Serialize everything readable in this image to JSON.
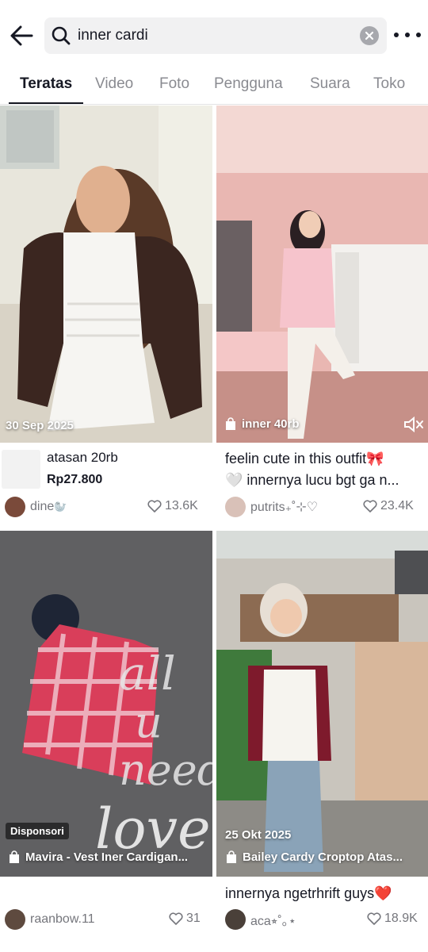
{
  "search": {
    "query": "inner cardi",
    "back_icon": "arrow-left-icon",
    "search_icon": "magnifier-icon",
    "clear_icon": "close-circle-icon",
    "more_icon": "more-dots-icon"
  },
  "tabs": [
    {
      "label": "Teratas",
      "active": true
    },
    {
      "label": "Video",
      "active": false
    },
    {
      "label": "Foto",
      "active": false
    },
    {
      "label": "Pengguna",
      "active": false
    },
    {
      "label": "Suara",
      "active": false
    },
    {
      "label": "Toko",
      "active": false
    }
  ],
  "results": [
    {
      "overlay_date": "30 Sep 2025",
      "product_title": "atasan 20rb",
      "product_price": "Rp27.800",
      "username": "dine",
      "username_emoji": "🦭",
      "likes": "13.6K"
    },
    {
      "overlay_product": "inner 40rb",
      "caption_line1": "feelin cute in this outfit🎀",
      "caption_line2": "🤍 innernya lucu bgt ga n...",
      "username": "putrits₊˚⊹♡",
      "likes": "23.4K",
      "mute_icon": "speaker-muted-icon"
    },
    {
      "sponsor_label": "Disponsori",
      "overlay_product": "Mavira - Vest Iner Cardigan...",
      "username": "raanbow.11",
      "likes": "31"
    },
    {
      "overlay_date": "25 Okt 2025",
      "overlay_product": "Bailey Cardy Croptop Atas...",
      "caption_line1": "innernya ngetrhrift guys❤️",
      "username": "aca⭒˚｡⋆",
      "likes": "18.9K"
    }
  ],
  "colors": {
    "text_primary": "#161823",
    "text_secondary": "#75767c",
    "tab_inactive": "#8a8b91",
    "search_bg": "#f1f1f2"
  }
}
